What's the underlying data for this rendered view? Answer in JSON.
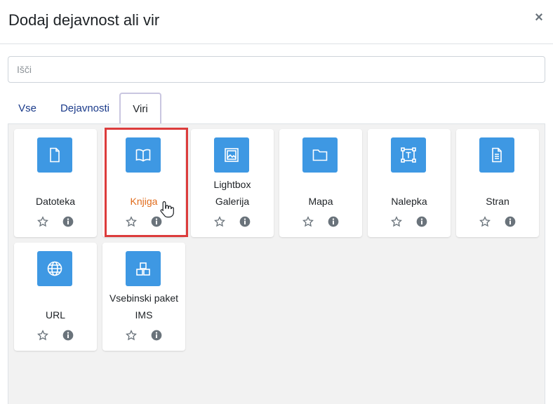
{
  "modal": {
    "title": "Dodaj dejavnost ali vir",
    "close_symbol": "×"
  },
  "search": {
    "placeholder": "Išči",
    "value": ""
  },
  "tabs": [
    {
      "label": "Vse",
      "active": false
    },
    {
      "label": "Dejavnosti",
      "active": false
    },
    {
      "label": "Viri",
      "active": true
    }
  ],
  "items": [
    {
      "label": "Datoteka",
      "icon": "file-icon"
    },
    {
      "label": "Knjiga",
      "icon": "book-icon",
      "highlighted": true
    },
    {
      "label": "Lightbox Galerija",
      "label_line1": "Lightbox",
      "label_line2": "Galerija",
      "icon": "image-gallery-icon"
    },
    {
      "label": "Mapa",
      "icon": "folder-icon"
    },
    {
      "label": "Nalepka",
      "icon": "text-label-icon"
    },
    {
      "label": "Stran",
      "icon": "page-icon"
    },
    {
      "label": "URL",
      "icon": "globe-icon"
    },
    {
      "label": "Vsebinski paket IMS",
      "label_line1": "Vsebinski paket",
      "label_line2": "IMS",
      "icon": "package-icon"
    }
  ],
  "colors": {
    "icon_bg": "#3e98e3",
    "highlight_border": "#dc3c3c",
    "highlight_text": "#e06b1b",
    "tab_text": "#1a3a8a"
  }
}
